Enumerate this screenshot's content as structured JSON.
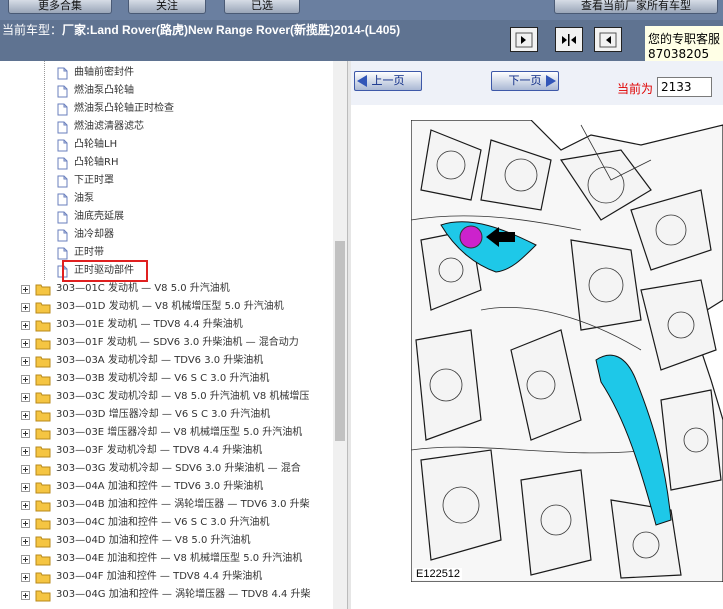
{
  "topbar": {
    "buttons": [
      "更多合集",
      "关注",
      "已选",
      "查看当前厂家所有车型"
    ]
  },
  "header": {
    "vehicle_prefix": "当前车型：",
    "vehicle_text": "厂家:Land Rover(路虎)New Range Rover(新揽胜)2014-(L405)",
    "contact_line1": "您的专职客服",
    "contact_line2": "87038205"
  },
  "tree": {
    "leaf_items": [
      "曲轴前密封件",
      "燃油泵凸轮轴",
      "燃油泵凸轮轴正时检查",
      "燃油滤清器滤芯",
      "凸轮轴LH",
      "凸轮轴RH",
      "下正时罩",
      "油泵",
      "油底壳延展",
      "油冷却器",
      "正时带",
      "正时驱动部件"
    ],
    "selected_item": "正时驱动部件",
    "folder_items": [
      "303—01C 发动机 — V8 5.0 升汽油机",
      "303—01D 发动机 — V8 机械增压型 5.0 升汽油机",
      "303—01E 发动机 — TDV8 4.4 升柴油机",
      "303—01F 发动机 — SDV6 3.0 升柴油机 — 混合动力",
      "303—03A 发动机冷却 — TDV6 3.0 升柴油机",
      "303—03B 发动机冷却 — V6 S C 3.0 升汽油机",
      "303—03C 发动机冷却 — V8 5.0 升汽油机 V8 机械增压",
      "303—03D 增压器冷却 — V6 S C 3.0 升汽油机",
      "303—03E 增压器冷却 — V8 机械增压型 5.0 升汽油机",
      "303—03F 发动机冷却 — TDV8 4.4 升柴油机",
      "303—03G 发动机冷却 — SDV6 3.0 升柴油机 — 混合",
      "303—04A 加油和控件 — TDV6 3.0 升柴油机",
      "303—04B 加油和控件 — 涡轮增压器 — TDV6 3.0 升柴",
      "303—04C 加油和控件 — V6 S C 3.0 升汽油机",
      "303—04D 加油和控件 — V8 5.0 升汽油机",
      "303—04E 加油和控件 — V8 机械增压型 5.0 升汽油机",
      "303—04F 加油和控件 — TDV8 4.4 升柴油机",
      "303—04G 加油和控件 — 涡轮增压器 — TDV8 4.4 升柴"
    ]
  },
  "viewer": {
    "prev_label": "上一页",
    "next_label": "下一页",
    "current_label": "当前为",
    "current_page": "2133",
    "figure_id": "E122512"
  },
  "colors": {
    "header_bg": "#5f7391",
    "highlight_border": "#e02020",
    "callout_magenta": "#cc22cc",
    "part_cyan": "#1ec8e8"
  }
}
